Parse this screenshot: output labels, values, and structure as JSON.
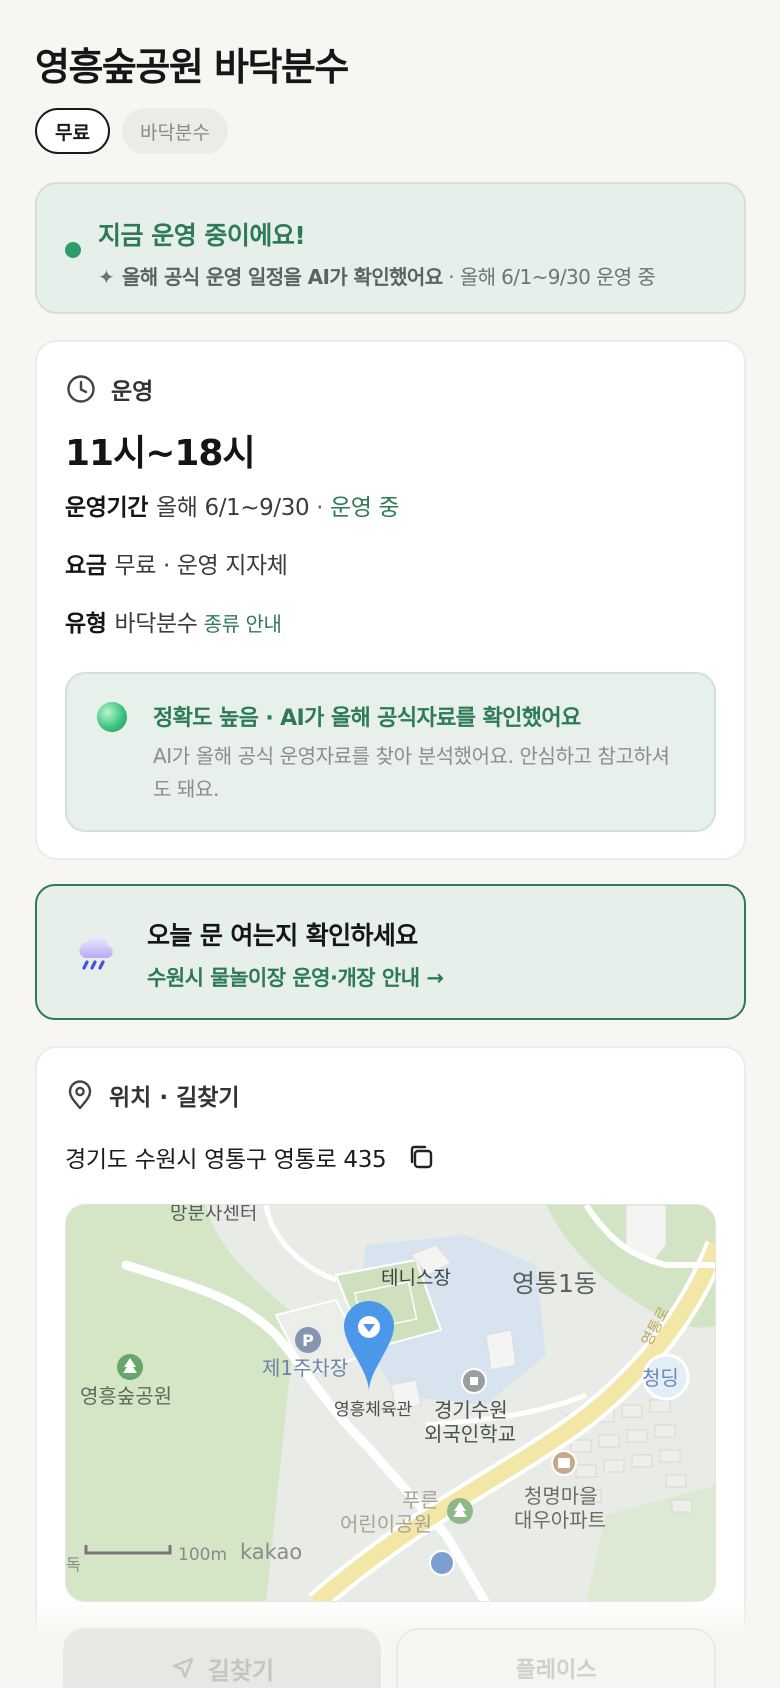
{
  "header": {
    "title": "영흥숲공원 바닥분수",
    "chips": [
      "무료",
      "바닥분수"
    ]
  },
  "status": {
    "title": "지금 운영 중이에요!",
    "sub_bold": "올해 공식 운영 일정을 AI가 확인했어요",
    "sub_rest": " · 올해 6/1~9/30 운영 중",
    "dot_color": "#2f9d6a"
  },
  "operation": {
    "heading": "운영",
    "icon": "clock-icon",
    "hours": "11시~18시",
    "period_key": "운영기간",
    "period_val": "올해 6/1~9/30",
    "period_status": " · 운영 중",
    "fee_key": "요금",
    "fee_val": "무료 · 운영 지자체",
    "type_key": "유형",
    "type_val": "바닥분수",
    "type_link": "종류 안내",
    "accuracy_title": "정확도 높음 · AI가 올해 공식자료를 확인했어요",
    "accuracy_desc": "AI가 올해 공식 운영자료를 찾아 분석했어요. 안심하고 참고하셔도 돼요."
  },
  "check": {
    "title": "오늘 문 여는지 확인하세요",
    "link": "수원시 물놀이장 운영·개장 안내 →",
    "icon": "rain-cloud-icon"
  },
  "location": {
    "heading": "위치 · 길찾기",
    "icon": "pin-icon",
    "address": "경기도 수원시 영통구 영통로 435",
    "copy_icon": "copy-icon",
    "map": {
      "labels": {
        "top_cut": "망분사센터",
        "tennis": "테니스장",
        "district": "영통1동",
        "parking": "제1주차장",
        "park": "영흥숲공원",
        "gym": "영흥체육관",
        "school_1": "경기수원",
        "school_2": "외국인학교",
        "road": "영통로",
        "edge": "청딩",
        "apt_1": "청명마을",
        "apt_2": "대우아파트",
        "kids_1": "푸른",
        "kids_2": "어린이공원",
        "scale": "100m",
        "brand": "kakao",
        "corner": "독"
      }
    }
  },
  "actions": {
    "directions": "길찾기",
    "place": "플레이스"
  }
}
